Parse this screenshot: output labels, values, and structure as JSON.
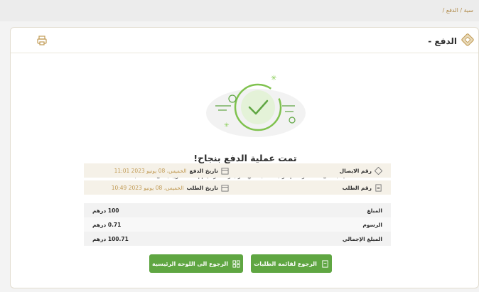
{
  "breadcrumb": {
    "prev": "سية",
    "separator": "/",
    "current": "الدفع /"
  },
  "page": {
    "title": "الدفع -"
  },
  "status": {
    "title": "تمت عملية الدفع بنجاح!",
    "subtitle": "لقد تلقينا بالفعل دفعتك وستتم مراجعة طلبك في أقرب وقت. وسيتم إعلامك قريبًا بشأن حالة طلبك"
  },
  "details": {
    "receipt_label": "رقم الايصال",
    "receipt_value": "",
    "payment_date_label": "تاريخ الدفع",
    "payment_date_value": "الخميس، 08 يونيو 2023 11:01",
    "request_label": "رقم الطلب",
    "request_value": "",
    "request_date_label": "تاريخ الطلب",
    "request_date_value": "الخميس، 08 يونيو 2023 10:49"
  },
  "amounts": [
    {
      "label": "المبلغ",
      "value": "100 درهم"
    },
    {
      "label": "الرسوم",
      "value": "0.71 درهم"
    },
    {
      "label": "المبلغ الإجمالي",
      "value": "100.71 درهم"
    }
  ],
  "buttons": {
    "back_requests": "الرجوع لقائمة الطلبات",
    "back_dashboard": "الرجوع الى اللوحة الرئيسية"
  },
  "colors": {
    "accent": "#5fa642",
    "gold": "#c19b55"
  }
}
